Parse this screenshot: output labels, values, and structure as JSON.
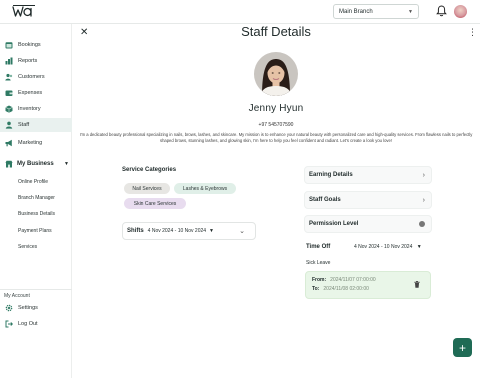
{
  "header": {
    "logo_text": "wa",
    "branch": "Main Branch",
    "icons": [
      "bell-icon",
      "user-avatar"
    ]
  },
  "sidebar": {
    "items": [
      {
        "label": "Bookings",
        "icon": "calendar-icon"
      },
      {
        "label": "Reports",
        "icon": "chart-icon"
      },
      {
        "label": "Customers",
        "icon": "users-icon"
      },
      {
        "label": "Expenses",
        "icon": "wallet-icon"
      },
      {
        "label": "Inventory",
        "icon": "box-icon"
      },
      {
        "label": "Staff",
        "icon": "staff-icon",
        "active": true
      },
      {
        "label": "Marketing",
        "icon": "megaphone-icon"
      }
    ],
    "business": {
      "label": "My Business",
      "subitems": [
        "Online Profile",
        "Branch Manager",
        "Business Details",
        "Payment Plans",
        "Services"
      ]
    },
    "account": {
      "label": "My Account",
      "items": [
        {
          "label": "Settings",
          "icon": "gear-icon"
        },
        {
          "label": "Log Out",
          "icon": "logout-icon"
        }
      ]
    }
  },
  "page": {
    "title": "Staff Details"
  },
  "staff": {
    "name": "Jenny Hyun",
    "phone": "+97 545707590",
    "bio": "I'm a dedicated beauty professional specializing in nails, brows, lashes, and skincare. My mission is to enhance your natural beauty with personalized care and high-quality services. From flawless nails to perfectly shaped brows, stunning lashes, and glowing skin, I'm here to help you feel confident and radiant. Let's create a look you love!"
  },
  "service_categories": {
    "title": "Service Categories",
    "chips": [
      "Nail Services",
      "Lashes & Eyebrows",
      "Skin Care Services"
    ]
  },
  "shifts": {
    "label": "Shifts",
    "range": "4 Nov 2024 - 10 Nov 2024"
  },
  "right_panel": {
    "earning": "Earning Details",
    "goals": "Staff Goals",
    "permission": "Permission Level",
    "time_off": {
      "label": "Time Off",
      "range": "4 Nov 2024 - 10 Nov 2024",
      "type": "Sick Leave",
      "from_label": "From:",
      "from_value": "2024/11/07 07:00:00",
      "to_label": "To:",
      "to_value": "2024/11/08 02:00:00"
    }
  },
  "fab": {
    "label": "+"
  },
  "colors": {
    "accent": "#1f6b55",
    "active_nav": "#e9f1ef",
    "leave_card": "#e9f6e8"
  }
}
